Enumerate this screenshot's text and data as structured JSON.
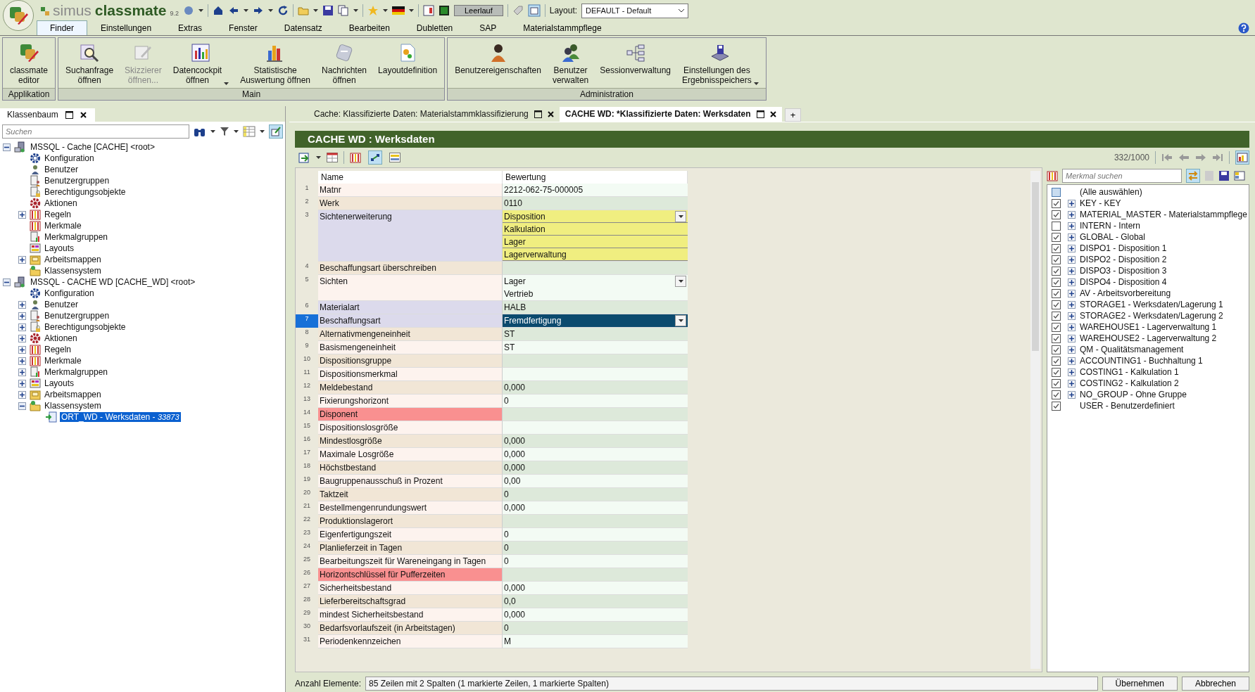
{
  "app": {
    "brand_light": "simus",
    "brand_bold": "classmate",
    "version": "9.2",
    "status_button": "Leerlauf",
    "layout_label": "Layout:",
    "layout_value": "DEFAULT - Default"
  },
  "menu_tabs": [
    {
      "label": "Finder",
      "selected": true
    },
    {
      "label": "Einstellungen",
      "selected": false
    },
    {
      "label": "Extras",
      "selected": false
    },
    {
      "label": "Fenster",
      "selected": false
    },
    {
      "label": "Datensatz",
      "selected": false
    },
    {
      "label": "Bearbeiten",
      "selected": false
    },
    {
      "label": "Dubletten",
      "selected": false
    },
    {
      "label": "SAP",
      "selected": false
    },
    {
      "label": "Materialstammpflege",
      "selected": false
    }
  ],
  "ribbon_groups": [
    {
      "title": "Applikation",
      "buttons": [
        {
          "kind": "editor",
          "label": "classmate\neditor",
          "disabled": false,
          "dropdown": false
        }
      ]
    },
    {
      "title": "Main",
      "buttons": [
        {
          "kind": "search",
          "label": "Suchanfrage\nöffnen",
          "disabled": false,
          "dropdown": false
        },
        {
          "kind": "sketch",
          "label": "Skizzierer\nöffnen...",
          "disabled": true,
          "dropdown": false
        },
        {
          "kind": "cockpit",
          "label": "Datencockpit\nöffnen",
          "disabled": false,
          "dropdown": true
        },
        {
          "kind": "stats",
          "label": "Statistische\nAuswertung öffnen",
          "disabled": false,
          "dropdown": false
        },
        {
          "kind": "messages",
          "label": "Nachrichten\nöffnen",
          "disabled": false,
          "dropdown": false
        },
        {
          "kind": "layout",
          "label": "Layoutdefinition",
          "disabled": false,
          "dropdown": false
        }
      ]
    },
    {
      "title": "Administration",
      "buttons": [
        {
          "kind": "person",
          "label": "Benutzereigenschaften",
          "disabled": false,
          "dropdown": false
        },
        {
          "kind": "people",
          "label": "Benutzer\nverwalten",
          "disabled": false,
          "dropdown": false
        },
        {
          "kind": "sessions",
          "label": "Sessionverwaltung",
          "disabled": false,
          "dropdown": false
        },
        {
          "kind": "storage",
          "label": "Einstellungen des\nErgebnisspeichers",
          "disabled": false,
          "dropdown": true
        }
      ]
    }
  ],
  "left_panel": {
    "title": "Klassenbaum",
    "search_placeholder": "Suchen",
    "tree": [
      {
        "kind": "server",
        "label": "MSSQL - Cache [CACHE] <root>",
        "expandable": true,
        "expanded": true,
        "selected": false,
        "children": [
          {
            "kind": "config",
            "label": "Konfiguration",
            "expandable": false,
            "selected": false
          },
          {
            "kind": "user",
            "label": "Benutzer",
            "expandable": false,
            "selected": false
          },
          {
            "kind": "group",
            "label": "Benutzergruppen",
            "expandable": false,
            "selected": false
          },
          {
            "kind": "permission",
            "label": "Berechtigungsobjekte",
            "expandable": false,
            "selected": false
          },
          {
            "kind": "action",
            "label": "Aktionen",
            "expandable": false,
            "selected": false
          },
          {
            "kind": "rules",
            "label": "Regeln",
            "expandable": true,
            "expanded": false,
            "selected": false
          },
          {
            "kind": "rules",
            "label": "Merkmale",
            "expandable": false,
            "selected": false
          },
          {
            "kind": "featuregroup",
            "label": "Merkmalgruppen",
            "expandable": false,
            "selected": false
          },
          {
            "kind": "layouts",
            "label": "Layouts",
            "expandable": false,
            "selected": false
          },
          {
            "kind": "workbook",
            "label": "Arbeitsmappen",
            "expandable": true,
            "expanded": false,
            "selected": false
          },
          {
            "kind": "classsystem",
            "label": "Klassensystem",
            "expandable": false,
            "selected": false
          }
        ]
      },
      {
        "kind": "server",
        "label": "MSSQL - CACHE WD [CACHE_WD] <root>",
        "expandable": true,
        "expanded": true,
        "selected": false,
        "children": [
          {
            "kind": "config",
            "label": "Konfiguration",
            "expandable": false,
            "selected": false
          },
          {
            "kind": "user",
            "label": "Benutzer",
            "expandable": true,
            "expanded": false,
            "selected": false
          },
          {
            "kind": "group",
            "label": "Benutzergruppen",
            "expandable": true,
            "expanded": false,
            "selected": false
          },
          {
            "kind": "permission",
            "label": "Berechtigungsobjekte",
            "expandable": true,
            "expanded": false,
            "selected": false
          },
          {
            "kind": "action",
            "label": "Aktionen",
            "expandable": true,
            "expanded": false,
            "selected": false
          },
          {
            "kind": "rules",
            "label": "Regeln",
            "expandable": true,
            "expanded": false,
            "selected": false
          },
          {
            "kind": "rules",
            "label": "Merkmale",
            "expandable": true,
            "expanded": false,
            "selected": false
          },
          {
            "kind": "featuregroup",
            "label": "Merkmalgruppen",
            "expandable": true,
            "expanded": false,
            "selected": false
          },
          {
            "kind": "layouts",
            "label": "Layouts",
            "expandable": true,
            "expanded": false,
            "selected": false
          },
          {
            "kind": "workbook",
            "label": "Arbeitsmappen",
            "expandable": true,
            "expanded": false,
            "selected": false
          },
          {
            "kind": "classsystem",
            "label": "Klassensystem",
            "expandable": true,
            "expanded": true,
            "selected": false,
            "children": [
              {
                "kind": "class",
                "label": "ORT_WD - Werksdaten - ",
                "count": "33873",
                "expandable": false,
                "selected": true
              }
            ]
          }
        ]
      }
    ]
  },
  "add_tab": "+",
  "doc_tabs": [
    {
      "label": "Cache: Klassifizierte Daten: Materialstammklassifizierung",
      "selected": false
    },
    {
      "label": "CACHE WD: *Klassifizierte Daten: Werksdaten",
      "selected": true
    }
  ],
  "pane": {
    "title": "CACHE WD : Werksdaten",
    "record_counter": "332/1000",
    "table": {
      "columns": [
        "Name",
        "Bewertung"
      ],
      "rows": [
        {
          "no": "1",
          "name": "Matnr",
          "modified": false,
          "missing": false,
          "values": [
            "2212-062-75-000005"
          ],
          "highlight": false,
          "dropdown": false,
          "selected": false
        },
        {
          "no": "2",
          "name": "Werk",
          "modified": false,
          "missing": false,
          "values": [
            "0110"
          ],
          "highlight": false,
          "dropdown": false,
          "selected": false
        },
        {
          "no": "3",
          "name": "Sichtenerweiterung",
          "modified": true,
          "missing": false,
          "values": [
            "Disposition",
            "Kalkulation",
            "Lager",
            "Lagerverwaltung"
          ],
          "highlight": true,
          "dropdown": true,
          "selected": false
        },
        {
          "no": "4",
          "name": "Beschaffungsart überschreiben",
          "modified": false,
          "missing": false,
          "values": [],
          "highlight": false,
          "dropdown": false,
          "selected": false
        },
        {
          "no": "5",
          "name": "Sichten",
          "modified": false,
          "missing": false,
          "values": [
            "Lager",
            "Vertrieb"
          ],
          "highlight": false,
          "dropdown": true,
          "selected": false
        },
        {
          "no": "6",
          "name": "Materialart",
          "modified": true,
          "missing": false,
          "values": [
            "HALB"
          ],
          "highlight": false,
          "dropdown": false,
          "selected": false
        },
        {
          "no": "7",
          "name": "Beschaffungsart",
          "modified": true,
          "missing": false,
          "values": [
            "Fremdfertigung"
          ],
          "highlight": false,
          "dropdown": true,
          "selected": true
        },
        {
          "no": "8",
          "name": "Alternativmengeneinheit",
          "modified": false,
          "missing": false,
          "values": [
            "ST"
          ],
          "highlight": false,
          "dropdown": false,
          "selected": false
        },
        {
          "no": "9",
          "name": "Basismengeneinheit",
          "modified": false,
          "missing": false,
          "values": [
            "ST"
          ],
          "highlight": false,
          "dropdown": false,
          "selected": false
        },
        {
          "no": "10",
          "name": "Dispositionsgruppe",
          "modified": false,
          "missing": false,
          "values": [],
          "highlight": false,
          "dropdown": false,
          "selected": false
        },
        {
          "no": "11",
          "name": "Dispositionsmerkmal",
          "modified": false,
          "missing": false,
          "values": [],
          "highlight": false,
          "dropdown": false,
          "selected": false
        },
        {
          "no": "12",
          "name": "Meldebestand",
          "modified": false,
          "missing": false,
          "values": [
            "0,000"
          ],
          "highlight": false,
          "dropdown": false,
          "selected": false
        },
        {
          "no": "13",
          "name": "Fixierungshorizont",
          "modified": false,
          "missing": false,
          "values": [
            "0"
          ],
          "highlight": false,
          "dropdown": false,
          "selected": false
        },
        {
          "no": "14",
          "name": "Disponent",
          "modified": false,
          "missing": true,
          "values": [],
          "highlight": false,
          "dropdown": false,
          "selected": false
        },
        {
          "no": "15",
          "name": "Dispositionslosgröße",
          "modified": false,
          "missing": false,
          "values": [],
          "highlight": false,
          "dropdown": false,
          "selected": false
        },
        {
          "no": "16",
          "name": "Mindestlosgröße",
          "modified": false,
          "missing": false,
          "values": [
            "0,000"
          ],
          "highlight": false,
          "dropdown": false,
          "selected": false
        },
        {
          "no": "17",
          "name": "Maximale Losgröße",
          "modified": false,
          "missing": false,
          "values": [
            "0,000"
          ],
          "highlight": false,
          "dropdown": false,
          "selected": false
        },
        {
          "no": "18",
          "name": "Höchstbestand",
          "modified": false,
          "missing": false,
          "values": [
            "0,000"
          ],
          "highlight": false,
          "dropdown": false,
          "selected": false
        },
        {
          "no": "19",
          "name": "Baugruppenausschuß in Prozent",
          "modified": false,
          "missing": false,
          "values": [
            "0,00"
          ],
          "highlight": false,
          "dropdown": false,
          "selected": false
        },
        {
          "no": "20",
          "name": "Taktzeit",
          "modified": false,
          "missing": false,
          "values": [
            "0"
          ],
          "highlight": false,
          "dropdown": false,
          "selected": false
        },
        {
          "no": "21",
          "name": "Bestellmengenrundungswert",
          "modified": false,
          "missing": false,
          "values": [
            "0,000"
          ],
          "highlight": false,
          "dropdown": false,
          "selected": false
        },
        {
          "no": "22",
          "name": "Produktionslagerort",
          "modified": false,
          "missing": false,
          "values": [],
          "highlight": false,
          "dropdown": false,
          "selected": false
        },
        {
          "no": "23",
          "name": "Eigenfertigungszeit",
          "modified": false,
          "missing": false,
          "values": [
            "0"
          ],
          "highlight": false,
          "dropdown": false,
          "selected": false
        },
        {
          "no": "24",
          "name": "Planlieferzeit in Tagen",
          "modified": false,
          "missing": false,
          "values": [
            "0"
          ],
          "highlight": false,
          "dropdown": false,
          "selected": false
        },
        {
          "no": "25",
          "name": "Bearbeitungszeit für Wareneingang in Tagen",
          "modified": false,
          "missing": false,
          "values": [
            "0"
          ],
          "highlight": false,
          "dropdown": false,
          "selected": false
        },
        {
          "no": "26",
          "name": "Horizontschlüssel für Pufferzeiten",
          "modified": false,
          "missing": true,
          "values": [],
          "highlight": false,
          "dropdown": false,
          "selected": false
        },
        {
          "no": "27",
          "name": "Sicherheitsbestand",
          "modified": false,
          "missing": false,
          "values": [
            "0,000"
          ],
          "highlight": false,
          "dropdown": false,
          "selected": false
        },
        {
          "no": "28",
          "name": "Lieferbereitschaftsgrad",
          "modified": false,
          "missing": false,
          "values": [
            "0,0"
          ],
          "highlight": false,
          "dropdown": false,
          "selected": false
        },
        {
          "no": "29",
          "name": "mindest Sicherheitsbestand",
          "modified": false,
          "missing": false,
          "values": [
            "0,000"
          ],
          "highlight": false,
          "dropdown": false,
          "selected": false
        },
        {
          "no": "30",
          "name": "Bedarfsvorlaufszeit (in Arbeitstagen)",
          "modified": false,
          "missing": false,
          "values": [
            "0"
          ],
          "highlight": false,
          "dropdown": false,
          "selected": false
        },
        {
          "no": "31",
          "name": "Periodenkennzeichen",
          "modified": false,
          "missing": false,
          "values": [
            "M"
          ],
          "highlight": false,
          "dropdown": false,
          "selected": false
        }
      ]
    },
    "feature_search_placeholder": "Merkmal suchen",
    "feature_groups": [
      {
        "label": "(Alle auswählen)",
        "checked": false,
        "partial": true,
        "expandable": false
      },
      {
        "label": "KEY - KEY",
        "checked": true,
        "partial": false,
        "expandable": true
      },
      {
        "label": "MATERIAL_MASTER - Materialstammpflege",
        "checked": true,
        "partial": false,
        "expandable": true
      },
      {
        "label": "INTERN - Intern",
        "checked": false,
        "partial": false,
        "expandable": true
      },
      {
        "label": "GLOBAL - Global",
        "checked": true,
        "partial": false,
        "expandable": true
      },
      {
        "label": "DISPO1 - Disposition 1",
        "checked": true,
        "partial": false,
        "expandable": true
      },
      {
        "label": "DISPO2 - Disposition 2",
        "checked": true,
        "partial": false,
        "expandable": true
      },
      {
        "label": "DISPO3 - Disposition 3",
        "checked": true,
        "partial": false,
        "expandable": true
      },
      {
        "label": "DISPO4 - Disposition 4",
        "checked": true,
        "partial": false,
        "expandable": true
      },
      {
        "label": "AV - Arbeitsvorbereitung",
        "checked": true,
        "partial": false,
        "expandable": true
      },
      {
        "label": "STORAGE1 - Werksdaten/Lagerung 1",
        "checked": true,
        "partial": false,
        "expandable": true
      },
      {
        "label": "STORAGE2 - Werksdaten/Lagerung 2",
        "checked": true,
        "partial": false,
        "expandable": true
      },
      {
        "label": "WAREHOUSE1 - Lagerverwaltung 1",
        "checked": true,
        "partial": false,
        "expandable": true
      },
      {
        "label": "WAREHOUSE2 - Lagerverwaltung 2",
        "checked": true,
        "partial": false,
        "expandable": true
      },
      {
        "label": "QM - Qualitätsmanagement",
        "checked": true,
        "partial": false,
        "expandable": true
      },
      {
        "label": "ACCOUNTING1 - Buchhaltung 1",
        "checked": true,
        "partial": false,
        "expandable": true
      },
      {
        "label": "COSTING1 - Kalkulation 1",
        "checked": true,
        "partial": false,
        "expandable": true
      },
      {
        "label": "COSTING2 - Kalkulation 2",
        "checked": true,
        "partial": false,
        "expandable": true
      },
      {
        "label": "NO_GROUP - Ohne Gruppe",
        "checked": true,
        "partial": false,
        "expandable": true
      },
      {
        "label": "USER - Benutzerdefiniert",
        "checked": true,
        "partial": false,
        "expandable": false
      }
    ],
    "status_label": "Anzahl Elemente:",
    "status_value": "85 Zeilen mit 2 Spalten (1 markierte Zeilen, 1 markierte Spalten)",
    "buttons": [
      "Übernehmen",
      "Abbrechen"
    ]
  }
}
